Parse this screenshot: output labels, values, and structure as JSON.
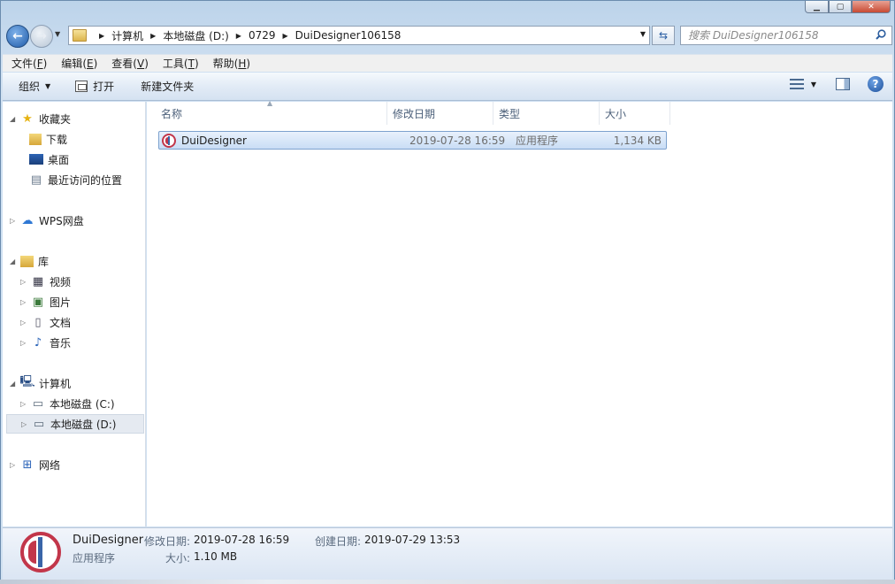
{
  "address": {
    "crumbs": [
      "计算机",
      "本地磁盘 (D:)",
      "0729",
      "DuiDesigner106158"
    ]
  },
  "search": {
    "placeholder": "搜索 DuiDesigner106158"
  },
  "menu": [
    {
      "label": "文件",
      "key": "F"
    },
    {
      "label": "编辑",
      "key": "E"
    },
    {
      "label": "查看",
      "key": "V"
    },
    {
      "label": "工具",
      "key": "T"
    },
    {
      "label": "帮助",
      "key": "H"
    }
  ],
  "toolbar": {
    "organize": "组织",
    "open": "打开",
    "new_folder": "新建文件夹"
  },
  "nav": {
    "favorites": "收藏夹",
    "downloads": "下载",
    "desktop": "桌面",
    "recent": "最近访问的位置",
    "wps": "WPS网盘",
    "libraries": "库",
    "videos": "视频",
    "pictures": "图片",
    "documents": "文档",
    "music": "音乐",
    "computer": "计算机",
    "drive_c": "本地磁盘 (C:)",
    "drive_d": "本地磁盘 (D:)",
    "network": "网络"
  },
  "columns": {
    "name": "名称",
    "modified": "修改日期",
    "type": "类型",
    "size": "大小"
  },
  "files": [
    {
      "name": "DuiDesigner",
      "modified": "2019-07-28 16:59",
      "type": "应用程序",
      "size": "1,134 KB"
    }
  ],
  "details": {
    "name": "DuiDesigner",
    "type": "应用程序",
    "modified_label": "修改日期:",
    "modified": "2019-07-28 16:59",
    "created_label": "创建日期:",
    "created": "2019-07-29 13:53",
    "size_label": "大小:",
    "size": "1.10 MB"
  }
}
